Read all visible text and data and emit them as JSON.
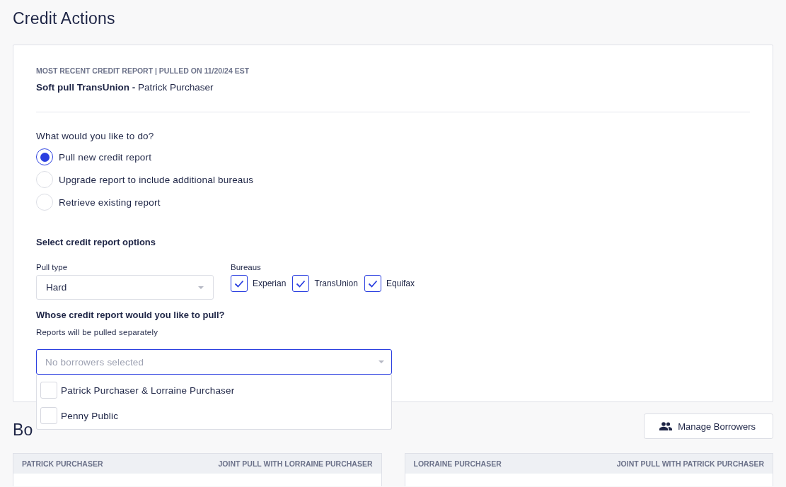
{
  "page_title": "Credit Actions",
  "report": {
    "caption": "MOST RECENT CREDIT REPORT | PULLED ON 11/20/24 EST",
    "summary": "**Soft pull TransUnion -** Patrick Purchaser"
  },
  "action": {
    "question": "What would you like to do?",
    "options": [
      {
        "label": "Pull new credit report",
        "selected": true
      },
      {
        "label": "Upgrade report to include additional bureaus",
        "selected": false
      },
      {
        "label": "Retrieve existing report",
        "selected": false
      }
    ]
  },
  "report_options": {
    "heading": "Select credit report options",
    "pull_type": {
      "label": "Pull type",
      "value": "Hard"
    },
    "bureaus": {
      "label": "Bureaus",
      "items": [
        {
          "label": "Experian",
          "checked": true
        },
        {
          "label": "TransUnion",
          "checked": true
        },
        {
          "label": "Equifax",
          "checked": true
        }
      ]
    }
  },
  "whose": {
    "question": "Whose credit report would you like to pull?",
    "note": "Reports will be pulled separately",
    "select": {
      "placeholder": "No borrowers selected",
      "expanded": true,
      "options": [
        {
          "label": "Patrick Purchaser & Lorraine Purchaser",
          "checked": false
        },
        {
          "label": "Penny Public",
          "checked": false
        }
      ]
    }
  },
  "borrowers": {
    "heading": "Bo",
    "manage_button": "Manage Borrowers",
    "cards": [
      {
        "name": "PATRICK PURCHASER",
        "joint": "JOINT PULL WITH LORRAINE PURCHASER"
      },
      {
        "name": "LORRAINE PURCHASER",
        "joint": "JOINT PULL WITH PATRICK PURCHASER"
      }
    ]
  }
}
